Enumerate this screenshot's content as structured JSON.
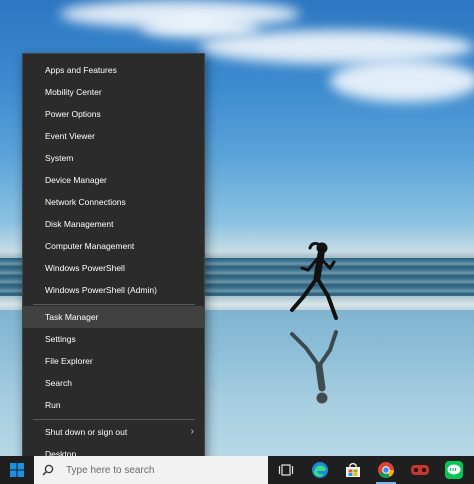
{
  "context_menu": {
    "items": [
      {
        "label": "Apps and Features"
      },
      {
        "label": "Mobility Center"
      },
      {
        "label": "Power Options"
      },
      {
        "label": "Event Viewer"
      },
      {
        "label": "System"
      },
      {
        "label": "Device Manager"
      },
      {
        "label": "Network Connections"
      },
      {
        "label": "Disk Management"
      },
      {
        "label": "Computer Management"
      },
      {
        "label": "Windows PowerShell"
      },
      {
        "label": "Windows PowerShell (Admin)"
      },
      {
        "label": "Task Manager"
      },
      {
        "label": "Settings"
      },
      {
        "label": "File Explorer"
      },
      {
        "label": "Search"
      },
      {
        "label": "Run"
      },
      {
        "label": "Shut down or sign out"
      },
      {
        "label": "Desktop"
      }
    ],
    "selected_label": "Task Manager"
  },
  "taskbar": {
    "search_placeholder": "Type here to search",
    "icons": [
      "task-view-icon",
      "edge-icon",
      "store-icon",
      "chrome-icon",
      "game-icon",
      "line-app-icon"
    ]
  },
  "colors": {
    "menu_bg": "#2b2b2b",
    "menu_selected": "#414141",
    "taskbar_bg": "#1f1f1f",
    "start_blue": "#1e90e0"
  }
}
